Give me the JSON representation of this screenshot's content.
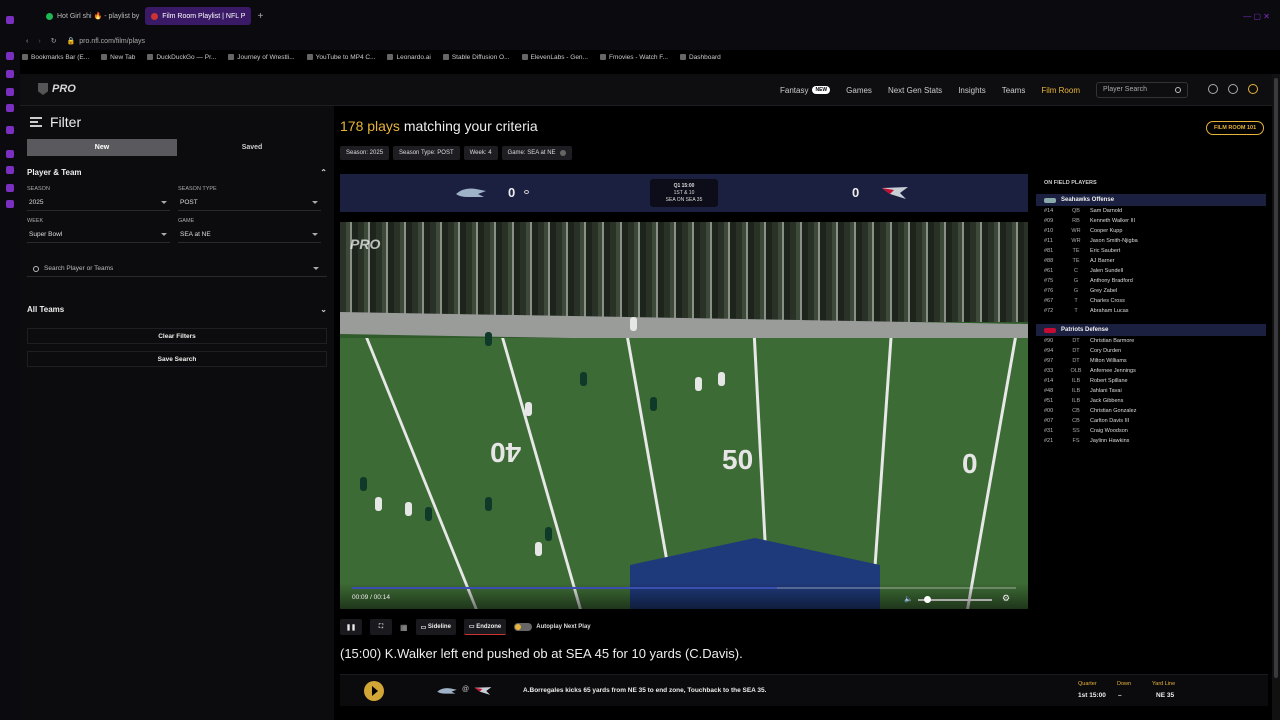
{
  "browser": {
    "tabs": [
      {
        "label": "Hot Girl shi 🔥 - playlist by",
        "color": "#1db954"
      },
      {
        "label": "Film Room Playlist | NFL P",
        "color": "#c33"
      }
    ],
    "url": "pro.nfl.com/film/plays",
    "bookmarks": [
      "Bookmarks Bar (E...",
      "New Tab",
      "DuckDuckGo — Pr...",
      "Journey of Wrestli...",
      "YouTube to MP4 C...",
      "Leonardo.ai",
      "Stable Diffusion O...",
      "ElevenLabs - Gen...",
      "Fmovies - Watch F...",
      "Dashboard"
    ]
  },
  "header": {
    "logo": "PRO",
    "nav": [
      {
        "label": "Fantasy",
        "badge": "NEW"
      },
      {
        "label": "Games"
      },
      {
        "label": "Next Gen Stats"
      },
      {
        "label": "Insights"
      },
      {
        "label": "Teams"
      },
      {
        "label": "Film Room",
        "active": true
      }
    ],
    "search_placeholder": "Player Search"
  },
  "filter": {
    "title": "Filter",
    "tabs": [
      "New",
      "Saved"
    ],
    "player_team_label": "Player & Team",
    "season_label": "SEASON",
    "season_value": "2025",
    "season_type_label": "SEASON TYPE",
    "season_type_value": "POST",
    "week_label": "WEEK",
    "week_value": "Super Bowl",
    "game_label": "GAME",
    "game_value": "SEA at NE",
    "search_placeholder": "Search Player or Teams",
    "all_teams": "All Teams",
    "clear_filters": "Clear Filters",
    "save_search": "Save Search"
  },
  "results": {
    "count": "178 plays",
    "suffix": "matching your criteria",
    "chips": [
      "Season: 2025",
      "Season Type: POST",
      "Week: 4",
      "Game: SEA at NE"
    ],
    "film_room_101": "FILM ROOM 101"
  },
  "scoreboard": {
    "home_score": "0",
    "away_score": "0",
    "clock_line1": "Q1 15:00",
    "clock_line2": "1ST & 10",
    "clock_line3": "SEA ON SEA 35",
    "home_color": "#69be28",
    "away_color": "#c60c30"
  },
  "video": {
    "watermark": "PRO",
    "time": "00:09 / 00:14",
    "progress": 0.64,
    "yard_numbers": [
      "40",
      "50",
      "0"
    ]
  },
  "controls": {
    "sideline": "Sideline",
    "endzone": "Endzone",
    "autoplay": "Autoplay Next Play"
  },
  "play_description": "(15:00) K.Walker left end pushed ob at SEA 45 for 10 yards (C.Davis).",
  "next_play": {
    "at": "@",
    "text": "A.Borregales kicks 65 yards from NE 35 to end zone, Touchback to the SEA 35.",
    "quarter_label": "Quarter",
    "quarter_value": "1st 15:00",
    "down_label": "Down",
    "down_value": "–",
    "yardline_label": "Yard Line",
    "yardline_value": "NE 35"
  },
  "on_field": {
    "title": "ON FIELD PLAYERS",
    "offense_title": "Seahawks Offense",
    "offense": [
      {
        "num": "#14",
        "pos": "QB",
        "name": "Sam Darnold"
      },
      {
        "num": "#09",
        "pos": "RB",
        "name": "Kenneth Walker III"
      },
      {
        "num": "#10",
        "pos": "WR",
        "name": "Cooper Kupp"
      },
      {
        "num": "#11",
        "pos": "WR",
        "name": "Jaxon Smith-Njigba"
      },
      {
        "num": "#81",
        "pos": "TE",
        "name": "Eric Saubert"
      },
      {
        "num": "#88",
        "pos": "TE",
        "name": "AJ Barner"
      },
      {
        "num": "#61",
        "pos": "C",
        "name": "Jalen Sundell"
      },
      {
        "num": "#75",
        "pos": "G",
        "name": "Anthony Bradford"
      },
      {
        "num": "#76",
        "pos": "G",
        "name": "Grey Zabel"
      },
      {
        "num": "#67",
        "pos": "T",
        "name": "Charles Cross"
      },
      {
        "num": "#72",
        "pos": "T",
        "name": "Abraham Lucas"
      }
    ],
    "defense_title": "Patriots Defense",
    "defense": [
      {
        "num": "#90",
        "pos": "DT",
        "name": "Christian Barmore"
      },
      {
        "num": "#94",
        "pos": "DT",
        "name": "Cory Durden"
      },
      {
        "num": "#97",
        "pos": "DT",
        "name": "Milton Williams"
      },
      {
        "num": "#33",
        "pos": "OLB",
        "name": "Anfernee Jennings"
      },
      {
        "num": "#14",
        "pos": "ILB",
        "name": "Robert Spillane"
      },
      {
        "num": "#48",
        "pos": "ILB",
        "name": "Jahlani Tavai"
      },
      {
        "num": "#51",
        "pos": "ILB",
        "name": "Jack Gibbens"
      },
      {
        "num": "#00",
        "pos": "CB",
        "name": "Christian Gonzalez"
      },
      {
        "num": "#07",
        "pos": "CB",
        "name": "Carlton Davis III"
      },
      {
        "num": "#31",
        "pos": "SS",
        "name": "Craig Woodson"
      },
      {
        "num": "#21",
        "pos": "FS",
        "name": "Jaylinn Hawkins"
      }
    ]
  }
}
